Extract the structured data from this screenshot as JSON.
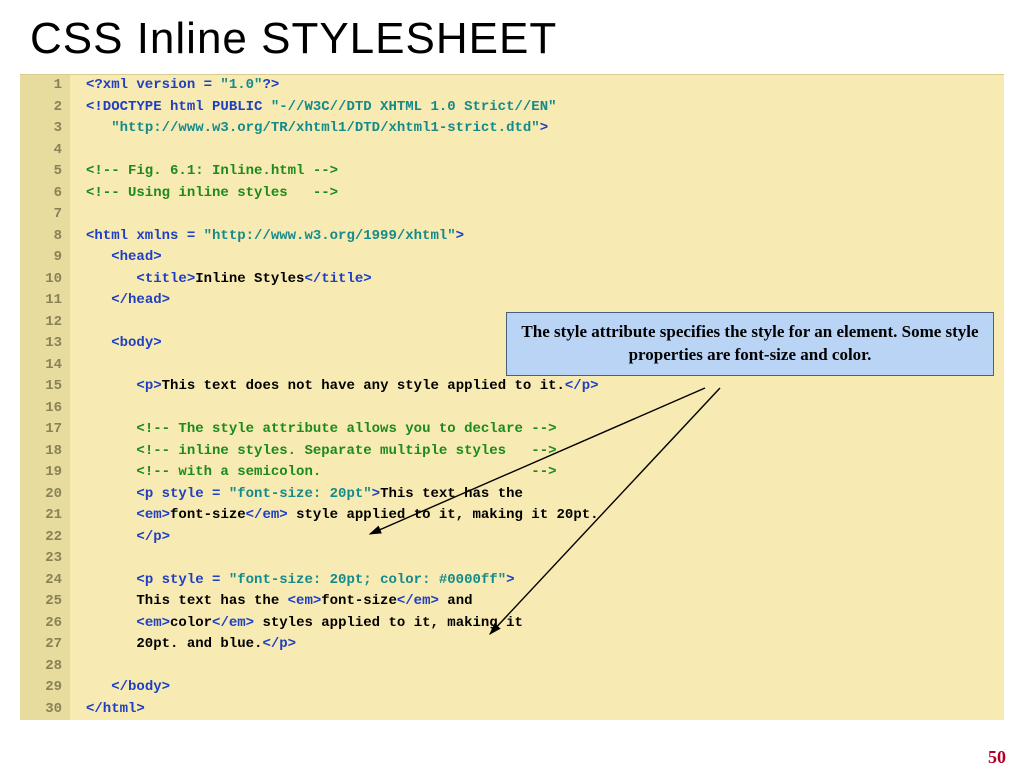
{
  "title": "CSS   Inline STYLESHEET",
  "callout": "The style attribute specifies the style for an element. Some style properties are font-size and color.",
  "pagenum": "50",
  "code": {
    "lines": [
      {
        "n": "1",
        "segs": [
          {
            "c": "blue",
            "t": "<?xml version = "
          },
          {
            "c": "teal",
            "t": "\"1.0\""
          },
          {
            "c": "blue",
            "t": "?>"
          }
        ]
      },
      {
        "n": "2",
        "segs": [
          {
            "c": "blue",
            "t": "<!DOCTYPE html PUBLIC "
          },
          {
            "c": "teal",
            "t": "\"-//W3C//DTD XHTML 1.0 Strict//EN\""
          }
        ]
      },
      {
        "n": "3",
        "segs": [
          {
            "c": "",
            "t": "   "
          },
          {
            "c": "teal",
            "t": "\"http://www.w3.org/TR/xhtml1/DTD/xhtml1-strict.dtd\""
          },
          {
            "c": "blue",
            "t": ">"
          }
        ]
      },
      {
        "n": "4",
        "segs": [
          {
            "c": "",
            "t": ""
          }
        ]
      },
      {
        "n": "5",
        "segs": [
          {
            "c": "green",
            "t": "<!-- Fig. 6.1: Inline.html -->"
          }
        ]
      },
      {
        "n": "6",
        "segs": [
          {
            "c": "green",
            "t": "<!-- Using inline styles   -->"
          }
        ]
      },
      {
        "n": "7",
        "segs": [
          {
            "c": "",
            "t": ""
          }
        ]
      },
      {
        "n": "8",
        "segs": [
          {
            "c": "blue",
            "t": "<html xmlns = "
          },
          {
            "c": "teal",
            "t": "\"http://www.w3.org/1999/xhtml\""
          },
          {
            "c": "blue",
            "t": ">"
          }
        ]
      },
      {
        "n": "9",
        "segs": [
          {
            "c": "",
            "t": "   "
          },
          {
            "c": "blue",
            "t": "<head>"
          }
        ]
      },
      {
        "n": "10",
        "segs": [
          {
            "c": "",
            "t": "      "
          },
          {
            "c": "blue",
            "t": "<title>"
          },
          {
            "c": "",
            "t": "Inline Styles"
          },
          {
            "c": "blue",
            "t": "</title>"
          }
        ]
      },
      {
        "n": "11",
        "segs": [
          {
            "c": "",
            "t": "   "
          },
          {
            "c": "blue",
            "t": "</head>"
          }
        ]
      },
      {
        "n": "12",
        "segs": [
          {
            "c": "",
            "t": ""
          }
        ]
      },
      {
        "n": "13",
        "segs": [
          {
            "c": "",
            "t": "   "
          },
          {
            "c": "blue",
            "t": "<body>"
          }
        ]
      },
      {
        "n": "14",
        "segs": [
          {
            "c": "",
            "t": ""
          }
        ]
      },
      {
        "n": "15",
        "segs": [
          {
            "c": "",
            "t": "      "
          },
          {
            "c": "blue",
            "t": "<p>"
          },
          {
            "c": "",
            "t": "This text does not have any style applied to it."
          },
          {
            "c": "blue",
            "t": "</p>"
          }
        ]
      },
      {
        "n": "16",
        "segs": [
          {
            "c": "",
            "t": ""
          }
        ]
      },
      {
        "n": "17",
        "segs": [
          {
            "c": "",
            "t": "      "
          },
          {
            "c": "green",
            "t": "<!-- The style attribute allows you to declare -->"
          }
        ]
      },
      {
        "n": "18",
        "segs": [
          {
            "c": "",
            "t": "      "
          },
          {
            "c": "green",
            "t": "<!-- inline styles. Separate multiple styles   -->"
          }
        ]
      },
      {
        "n": "19",
        "segs": [
          {
            "c": "",
            "t": "      "
          },
          {
            "c": "green",
            "t": "<!-- with a semicolon.                         -->"
          }
        ]
      },
      {
        "n": "20",
        "segs": [
          {
            "c": "",
            "t": "      "
          },
          {
            "c": "blue",
            "t": "<p style = "
          },
          {
            "c": "teal",
            "t": "\"font-size: 20pt\""
          },
          {
            "c": "blue",
            "t": ">"
          },
          {
            "c": "",
            "t": "This text has the"
          }
        ]
      },
      {
        "n": "21",
        "segs": [
          {
            "c": "",
            "t": "      "
          },
          {
            "c": "blue",
            "t": "<em>"
          },
          {
            "c": "",
            "t": "font-size"
          },
          {
            "c": "blue",
            "t": "</em>"
          },
          {
            "c": "",
            "t": " style applied to it, making it 20pt."
          }
        ]
      },
      {
        "n": "22",
        "segs": [
          {
            "c": "",
            "t": "      "
          },
          {
            "c": "blue",
            "t": "</p>"
          }
        ]
      },
      {
        "n": "23",
        "segs": [
          {
            "c": "",
            "t": ""
          }
        ]
      },
      {
        "n": "24",
        "segs": [
          {
            "c": "",
            "t": "      "
          },
          {
            "c": "blue",
            "t": "<p style = "
          },
          {
            "c": "teal",
            "t": "\"font-size: 20pt; color: #0000ff\""
          },
          {
            "c": "blue",
            "t": ">"
          }
        ]
      },
      {
        "n": "25",
        "segs": [
          {
            "c": "",
            "t": "      This text has the "
          },
          {
            "c": "blue",
            "t": "<em>"
          },
          {
            "c": "",
            "t": "font-size"
          },
          {
            "c": "blue",
            "t": "</em>"
          },
          {
            "c": "",
            "t": " and"
          }
        ]
      },
      {
        "n": "26",
        "segs": [
          {
            "c": "",
            "t": "      "
          },
          {
            "c": "blue",
            "t": "<em>"
          },
          {
            "c": "",
            "t": "color"
          },
          {
            "c": "blue",
            "t": "</em>"
          },
          {
            "c": "",
            "t": " styles applied to it, making it"
          }
        ]
      },
      {
        "n": "27",
        "segs": [
          {
            "c": "",
            "t": "      20pt. and blue."
          },
          {
            "c": "blue",
            "t": "</p>"
          }
        ]
      },
      {
        "n": "28",
        "segs": [
          {
            "c": "",
            "t": ""
          }
        ]
      },
      {
        "n": "29",
        "segs": [
          {
            "c": "",
            "t": "   "
          },
          {
            "c": "blue",
            "t": "</body>"
          }
        ]
      },
      {
        "n": "30",
        "segs": [
          {
            "c": "blue",
            "t": "</html>"
          }
        ]
      }
    ]
  }
}
